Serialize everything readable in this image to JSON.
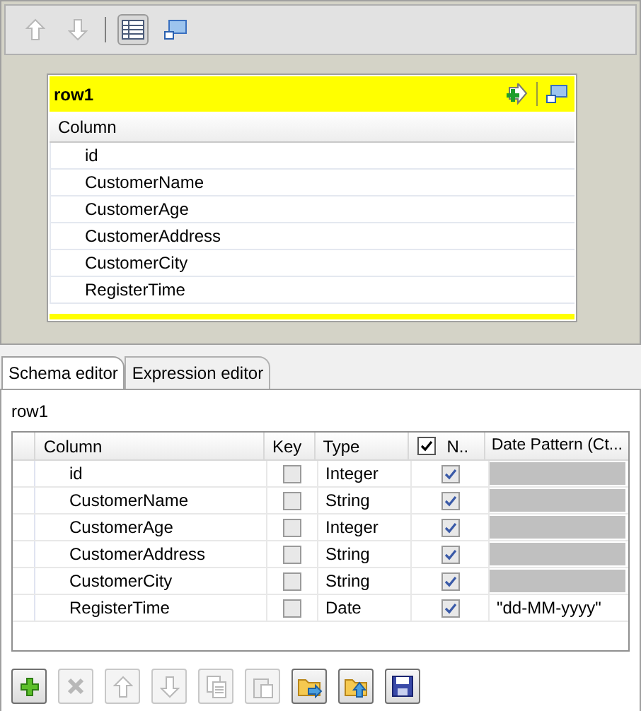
{
  "top_toolbar": [
    {
      "kind": "up",
      "disabled": true,
      "selected": false
    },
    {
      "kind": "down",
      "disabled": true,
      "selected": false
    },
    {
      "kind": "table",
      "disabled": false,
      "selected": true
    },
    {
      "kind": "window",
      "disabled": false,
      "selected": false
    }
  ],
  "card": {
    "title": "row1",
    "column_header": "Column",
    "columns": [
      "id",
      "CustomerName",
      "CustomerAge",
      "CustomerAddress",
      "CustomerCity",
      "RegisterTime"
    ]
  },
  "tabs": [
    {
      "label": "Schema editor",
      "selected": true
    },
    {
      "label": "Expression editor",
      "selected": false
    }
  ],
  "schema": {
    "title": "row1",
    "headers": {
      "column": "Column",
      "key": "Key",
      "type": "Type",
      "nullable": "N..",
      "nullable_all_checked": true,
      "date_pattern": "Date Pattern (Ct..."
    },
    "rows": [
      {
        "column": "id",
        "key": false,
        "type": "Integer",
        "nullable": true,
        "pattern_editable": false
      },
      {
        "column": "CustomerName",
        "key": false,
        "type": "String",
        "nullable": true,
        "pattern_editable": false
      },
      {
        "column": "CustomerAge",
        "key": false,
        "type": "Integer",
        "nullable": true,
        "pattern_editable": false
      },
      {
        "column": "CustomerAddress",
        "key": false,
        "type": "String",
        "nullable": true,
        "pattern_editable": false
      },
      {
        "column": "CustomerCity",
        "key": false,
        "type": "String",
        "nullable": true,
        "pattern_editable": false
      },
      {
        "column": "RegisterTime",
        "key": false,
        "type": "Date",
        "nullable": true,
        "pattern_editable": true,
        "date_pattern": "\"dd-MM-yyyy\""
      }
    ]
  },
  "bottom_toolbar": [
    {
      "kind": "add",
      "disabled": false
    },
    {
      "kind": "remove",
      "disabled": true
    },
    {
      "kind": "up",
      "disabled": true
    },
    {
      "kind": "down",
      "disabled": true
    },
    {
      "kind": "copy",
      "disabled": true
    },
    {
      "kind": "paste",
      "disabled": true
    },
    {
      "kind": "import",
      "disabled": false
    },
    {
      "kind": "export",
      "disabled": false
    },
    {
      "kind": "save",
      "disabled": false
    }
  ]
}
